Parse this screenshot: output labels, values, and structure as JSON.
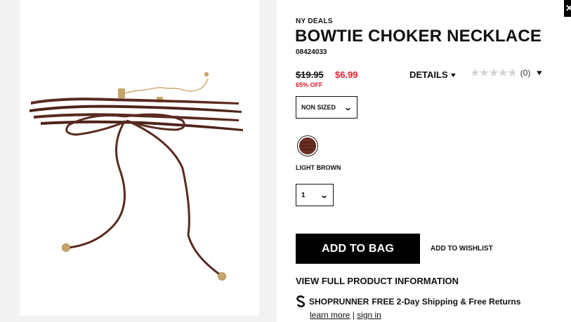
{
  "product": {
    "brand": "NY DEALS",
    "title": "BOWTIE CHOKER NECKLACE",
    "sku": "08424033",
    "price_original": "$19.95",
    "price_sale": "$6.99",
    "discount": "65% OFF"
  },
  "details": {
    "label": "DETAILS"
  },
  "rating": {
    "stars_glyphs": "★★★★★",
    "count": "(0)"
  },
  "size": {
    "selected": "NON SIZED"
  },
  "color": {
    "label": "LIGHT BROWN",
    "swatch_hex": "#6b2f22"
  },
  "quantity": {
    "selected": "1"
  },
  "actions": {
    "add_to_bag": "ADD TO BAG",
    "add_to_wishlist": "ADD TO WISHLIST",
    "view_full_info": "VIEW FULL PRODUCT INFORMATION"
  },
  "shoprunner": {
    "name": "SHOPRUNNER",
    "offer": "FREE 2-Day Shipping & Free Returns",
    "learn_more": "learn more",
    "separator": "|",
    "sign_in": "sign in"
  },
  "icons": {
    "chevron": "chevron-down-icon",
    "close": "close-icon",
    "star": "star-icon",
    "shoprunner_logo": "shoprunner-logo-icon"
  },
  "colors": {
    "sale_red": "#e41b2c",
    "button_black": "#000000",
    "product_brown": "#5a2a20"
  }
}
